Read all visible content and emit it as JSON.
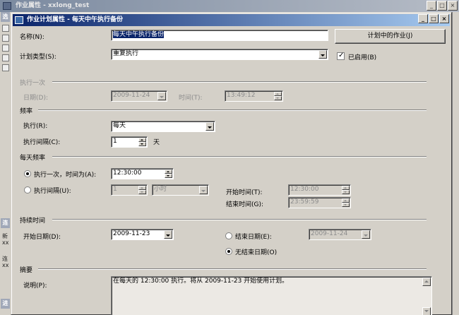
{
  "background_window": {
    "title": "作业属性 - xxlong_test",
    "left_strip": {
      "tab_top": "选",
      "tab_mid": "连",
      "tab_bottom": "进",
      "item_a": "新",
      "item_a2": "xx",
      "item_b": "连",
      "item_b2": "xx"
    }
  },
  "dialog": {
    "title": "作业计划属性 - 每天中午执行备份",
    "controls": {
      "minimize": "_",
      "maximize": "□",
      "close": "×"
    },
    "name_label": "名称(N):",
    "name_value": "每天中午执行备份",
    "jobs_button": "计划中的作业(J)",
    "schedule_type_label": "计划类型(S):",
    "schedule_type_value": "重复执行",
    "enabled_label": "已启用(B)",
    "enabled": true,
    "once": {
      "section": "执行一次",
      "date_label": "日期(D):",
      "date_value": "2009-11-24",
      "time_label": "时间(T):",
      "time_value": "13:49:12"
    },
    "frequency": {
      "section": "频率",
      "occurs_label": "执行(R):",
      "occurs_value": "每天",
      "interval_label": "执行间隔(C):",
      "interval_value": "1",
      "interval_unit": "天"
    },
    "daily": {
      "section": "每天频率",
      "once_label": "执行一次，时间为(A):",
      "once_time": "12:30:00",
      "once_selected": true,
      "every_label": "执行间隔(U):",
      "every_value": "1",
      "every_unit": "小时",
      "start_label": "开始时间(T):",
      "start_value": "12:30:00",
      "end_label": "结束时间(G):",
      "end_value": "23:59:59"
    },
    "duration": {
      "section": "持续时间",
      "start_label": "开始日期(D):",
      "start_value": "2009-11-23",
      "end_label": "结束日期(E):",
      "end_value": "2009-11-24",
      "noend_label": "无结束日期(O)",
      "noend_selected": true
    },
    "summary": {
      "section": "摘要",
      "desc_label": "说明(P):",
      "desc_value": "在每天的 12:30:00 执行。将从 2009-11-23 开始使用计划。"
    }
  }
}
